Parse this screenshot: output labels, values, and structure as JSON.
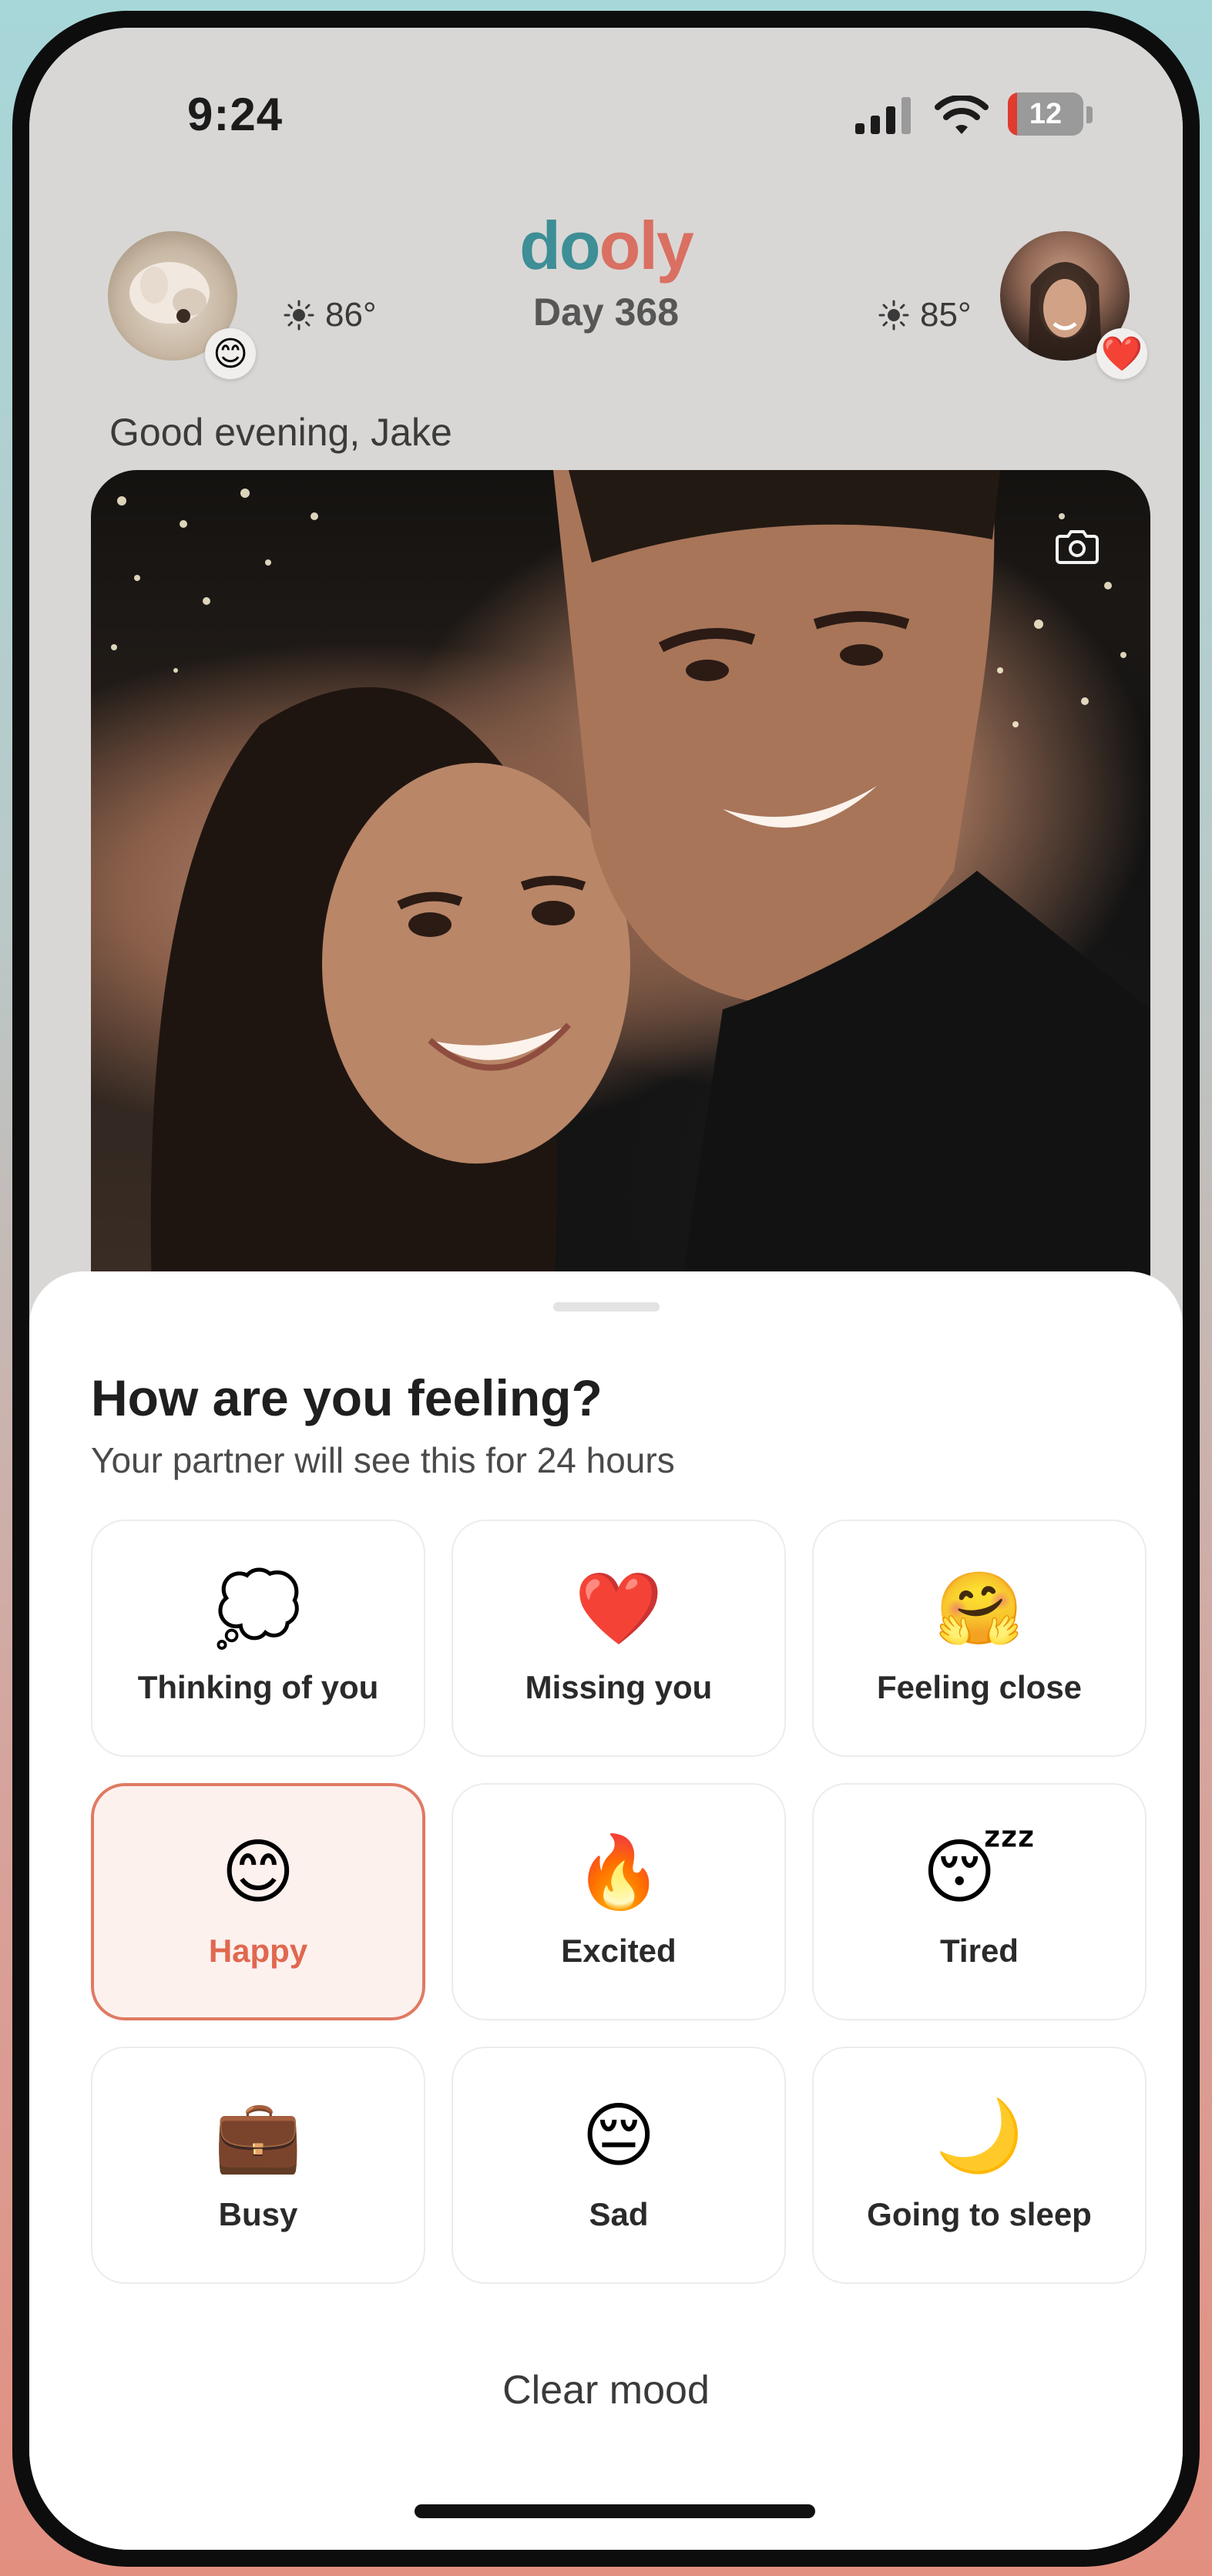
{
  "status_bar": {
    "time": "9:24",
    "battery": "12",
    "battery_level": 0.12
  },
  "header": {
    "logo": {
      "d": "d",
      "o1": "o",
      "o2": "o",
      "l": "l",
      "y": "y"
    },
    "day_label": "Day 368",
    "my_weather": "86°",
    "partner_weather": "85°",
    "my_mood_badge": "😊",
    "partner_badge": "❤️"
  },
  "greeting": "Good evening, Jake",
  "sheet": {
    "title": "How are you feeling?",
    "subtitle": "Your partner will see this for 24 hours",
    "moods": [
      {
        "emoji": "💭",
        "label": "Thinking of you",
        "icon": "thought-bubble-icon"
      },
      {
        "emoji": "❤️",
        "label": "Missing you",
        "icon": "heart-icon"
      },
      {
        "emoji": "🤗",
        "label": "Feeling close",
        "icon": "hugging-face-icon"
      },
      {
        "emoji": "😊",
        "label": "Happy",
        "icon": "smiling-face-icon",
        "selected": true
      },
      {
        "emoji": "🔥",
        "label": "Excited",
        "icon": "fire-icon"
      },
      {
        "emoji": "😴",
        "label": "Tired",
        "icon": "sleeping-face-icon"
      },
      {
        "emoji": "💼",
        "label": "Busy",
        "icon": "briefcase-icon"
      },
      {
        "emoji": "😔",
        "label": "Sad",
        "icon": "pensive-face-icon"
      },
      {
        "emoji": "🌙",
        "label": "Going to sleep",
        "icon": "crescent-moon-icon"
      }
    ],
    "clear_label": "Clear mood"
  },
  "colors": {
    "brand_teal": "#3d8e96",
    "brand_coral": "#d97062",
    "selected_border": "#e07a63",
    "selected_bg": "#fdf1ee"
  }
}
